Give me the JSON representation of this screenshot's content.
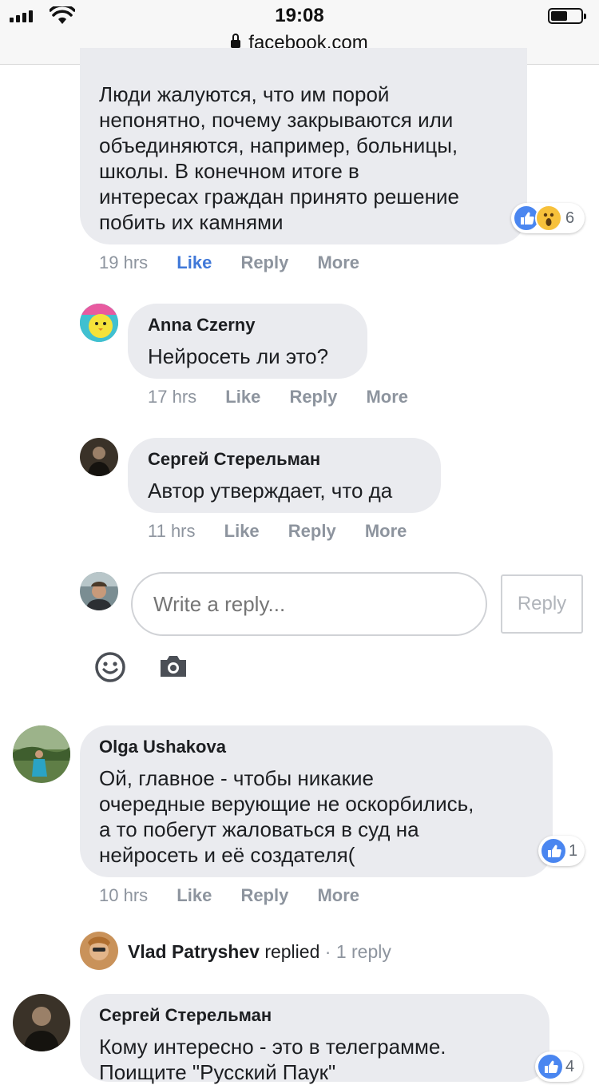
{
  "status_bar": {
    "time": "19:08",
    "url": "facebook.com"
  },
  "colors": {
    "bubble": "#eaebef",
    "meta": "#8d949e",
    "like_blue": "#4078d8",
    "reaction_like": "#4a86f0",
    "reaction_wow": "#f7c13b"
  },
  "comments": [
    {
      "text_lines": [
        "Люди жалуются, что им порой",
        "непонятно, почему закрываются или",
        "объединяются, например, больницы,",
        "школы. В конечном итоге в",
        "интересах граждан принято решение",
        "побить их камнями"
      ],
      "reaction_icons": [
        "like-icon",
        "wow-icon"
      ],
      "reaction_count": "6",
      "time": "19 hrs",
      "like": "Like",
      "reply": "Reply",
      "more": "More"
    },
    {
      "name": "Anna Czerny",
      "text": "Нейросеть ли это?",
      "time": "17 hrs",
      "like": "Like",
      "reply": "Reply",
      "more": "More"
    },
    {
      "name": "Сергей Стерельман",
      "text": "Автор утверждает, что да",
      "time": "11 hrs",
      "like": "Like",
      "reply": "Reply",
      "more": "More"
    },
    {
      "name": "Olga Ushakova",
      "text_lines": [
        "Ой, главное - чтобы никакие",
        "очередные верующие не оскорбились,",
        "а то побегут жаловаться в суд на",
        "нейросеть и её создателя("
      ],
      "reaction_icons": [
        "like-icon"
      ],
      "reaction_count": "1",
      "time": "10 hrs",
      "like": "Like",
      "reply": "Reply",
      "more": "More"
    },
    {
      "name": "Сергей Стерельман",
      "text_lines": [
        "Кому интересно - это в телеграмме.",
        "Поищите \"Русский Паук\""
      ],
      "reaction_icons": [
        "like-icon"
      ],
      "reaction_count": "4"
    }
  ],
  "reply_box": {
    "placeholder": "Write a reply...",
    "button": "Reply",
    "icons": [
      "emoji-icon",
      "camera-icon"
    ]
  },
  "replied_summary": {
    "name": "Vlad Patryshev",
    "verb": "replied",
    "separator": "·",
    "count": "1 reply"
  }
}
